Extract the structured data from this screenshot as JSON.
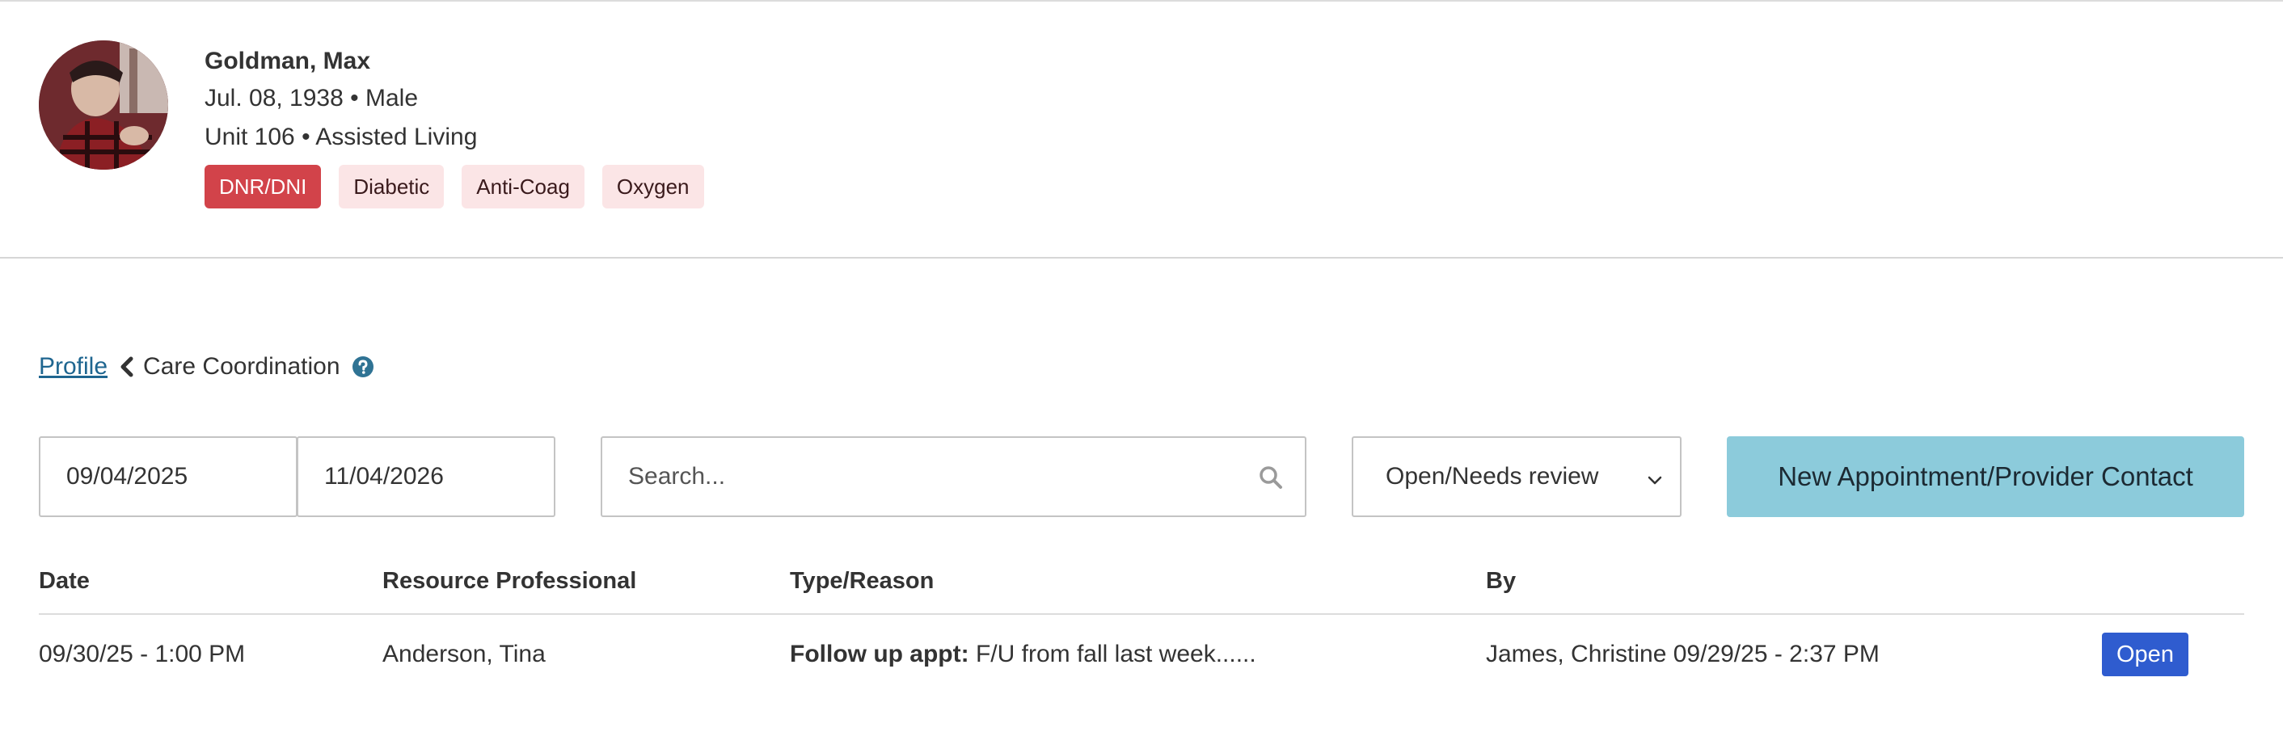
{
  "patient": {
    "name": "Goldman, Max",
    "dob": "Jul. 08, 1938",
    "sex": "Male",
    "unit": "Unit 106",
    "care_level": "Assisted Living",
    "flags": [
      "DNR/DNI",
      "Diabetic",
      "Anti-Coag",
      "Oxygen"
    ]
  },
  "breadcrumb": {
    "parent": "Profile",
    "current": "Care Coordination"
  },
  "filters": {
    "date_start": "09/04/2025",
    "date_end": "11/04/2026",
    "search_placeholder": "Search...",
    "status_selected": "Open/Needs review",
    "new_button": "New Appointment/Provider Contact"
  },
  "table": {
    "columns": [
      "Date",
      "Resource Professional",
      "Type/Reason",
      "By"
    ],
    "rows": [
      {
        "date": "09/30/25 - 1:00 PM",
        "professional": "Anderson, Tina",
        "type": "Follow up appt:",
        "reason": "F/U from fall last week......",
        "by": "James, Christine 09/29/25 - 2:37 PM",
        "status": "Open"
      }
    ]
  },
  "colors": {
    "link": "#1f6690",
    "danger_flag": "#d2434a",
    "soft_flag": "#fbe5e6",
    "primary_button": "#8ccbdb",
    "status_badge": "#2f5ccf"
  },
  "icons": [
    "avatar-photo",
    "chevron-left-icon",
    "help-circle-icon",
    "search-icon",
    "chevron-down-icon"
  ]
}
